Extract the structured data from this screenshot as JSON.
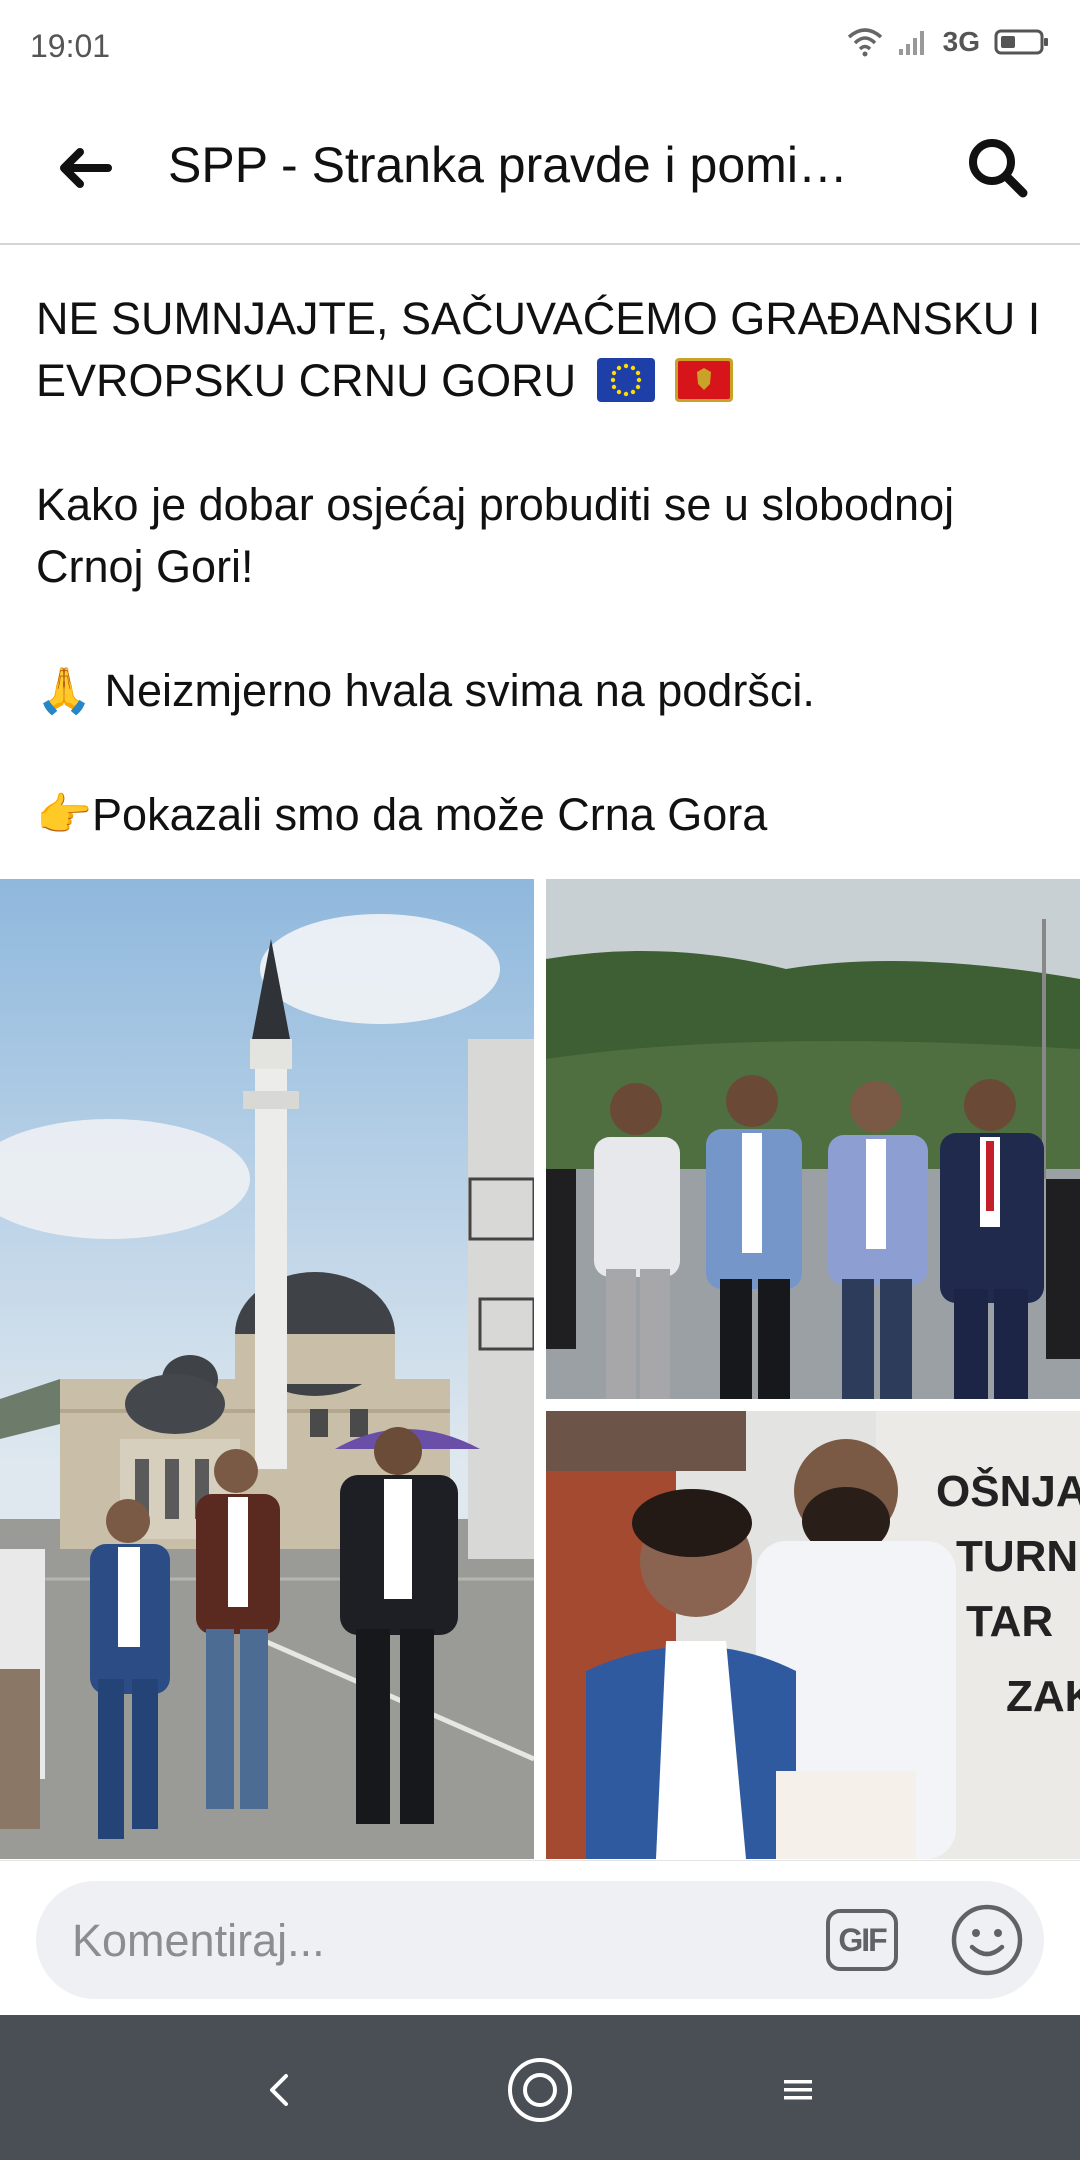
{
  "status": {
    "time": "19:01",
    "network": "3G",
    "icons": [
      "wifi-icon",
      "signal-icon",
      "battery-icon"
    ]
  },
  "header": {
    "title": "SPP - Stranka pravde i pomi…",
    "back_icon": "back-arrow-icon",
    "search_icon": "search-icon"
  },
  "post": {
    "lines": [
      "NE SUMNJAJTE, SAČUVAĆEMO GRAĐANSKU I EVROPSKU CRNU GORU",
      "Kako je dobar osjećaj probuditi se u slobodnoj Crnoj Gori!",
      "🙏 Neizmjerno hvala svima na podršci.",
      "👉Pokazali smo da može Crna Gora"
    ],
    "flag_icons": [
      "eu-flag-icon",
      "montenegro-flag-icon"
    ]
  },
  "photos": [
    {
      "name": "photo-mosque-street",
      "description_icon": "photo"
    },
    {
      "name": "photo-group-hillside",
      "description_icon": "photo"
    },
    {
      "name": "photo-two-men-wall",
      "description_icon": "photo"
    }
  ],
  "wall_text": {
    "line1": "OŠNJAČKI",
    "line2": "TURNI",
    "line3": "TAR",
    "line4": "ZAK"
  },
  "comment": {
    "placeholder": "Komentiraj...",
    "gif_label": "GIF",
    "emoji_icon": "smiley-icon"
  },
  "nav": {
    "icons": [
      "nav-back-icon",
      "nav-home-icon",
      "nav-menu-icon"
    ]
  },
  "colors": {
    "nav_bg": "#4a4f55",
    "comment_bg": "#eef0f3",
    "eu_blue": "#1f3fa8",
    "montenegro_red": "#d7141a"
  }
}
